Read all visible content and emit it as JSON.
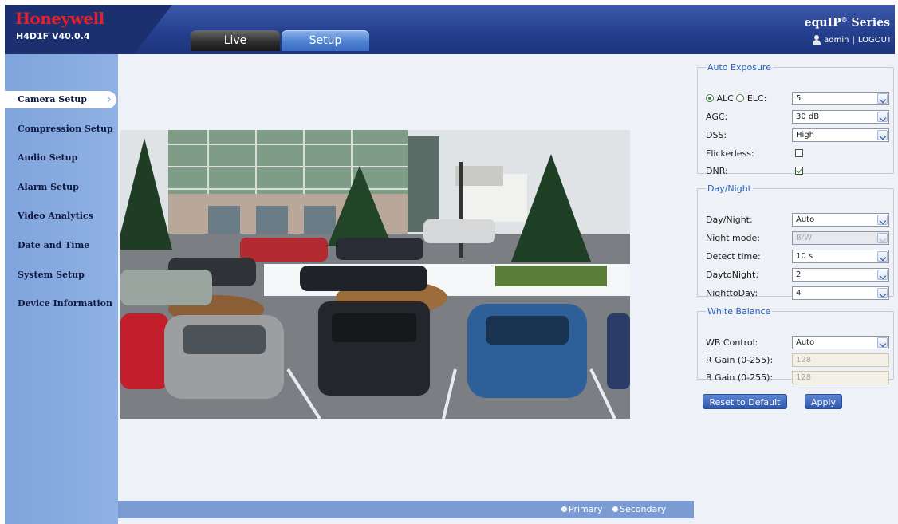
{
  "header": {
    "brand": "Honeywell",
    "model": "H4D1F V40.0.4",
    "series_name": "equIP",
    "series_reg": "®",
    "series_suffix": " Series",
    "user": "admin",
    "separator": "|",
    "logout": "LOGOUT"
  },
  "tabs": [
    {
      "label": "Live",
      "active": false
    },
    {
      "label": "Setup",
      "active": true
    }
  ],
  "sidebar": {
    "items": [
      {
        "label": "Camera Setup",
        "active": true
      },
      {
        "label": "Compression Setup",
        "active": false
      },
      {
        "label": "Audio Setup",
        "active": false
      },
      {
        "label": "Alarm Setup",
        "active": false
      },
      {
        "label": "Video Analytics",
        "active": false
      },
      {
        "label": "Date and Time",
        "active": false
      },
      {
        "label": "System Setup",
        "active": false
      },
      {
        "label": "Device Information",
        "active": false
      }
    ]
  },
  "stream": {
    "primary": "Primary",
    "secondary": "Secondary",
    "selected": "Primary"
  },
  "auto_exposure": {
    "legend": "Auto Exposure",
    "alc_label": "ALC",
    "elc_label": "ELC:",
    "mode_selected": "ALC",
    "level_value": "5",
    "agc_label": "AGC:",
    "agc_value": "30 dB",
    "dss_label": "DSS:",
    "dss_value": "High",
    "flickerless_label": "Flickerless:",
    "flickerless_checked": false,
    "dnr_label": "DNR:",
    "dnr_checked": true
  },
  "day_night": {
    "legend": "Day/Night",
    "mode_label": "Day/Night:",
    "mode_value": "Auto",
    "night_mode_label": "Night mode:",
    "night_mode_value": "B/W",
    "detect_time_label": "Detect time:",
    "detect_time_value": "10 s",
    "day_to_night_label": "DaytoNight:",
    "day_to_night_value": "2",
    "night_to_day_label": "NighttoDay:",
    "night_to_day_value": "4"
  },
  "white_balance": {
    "legend": "White Balance",
    "wb_control_label": "WB Control:",
    "wb_control_value": "Auto",
    "r_gain_label": "R Gain (0-255):",
    "r_gain_value": "128",
    "b_gain_label": "B Gain (0-255):",
    "b_gain_value": "128"
  },
  "buttons": {
    "reset": "Reset to Default",
    "apply": "Apply"
  },
  "colors": {
    "header_blue": "#24408f",
    "brand_red": "#e4202a",
    "sidebar_blue": "#8fb1e4",
    "legend_blue": "#2a5fb8"
  }
}
